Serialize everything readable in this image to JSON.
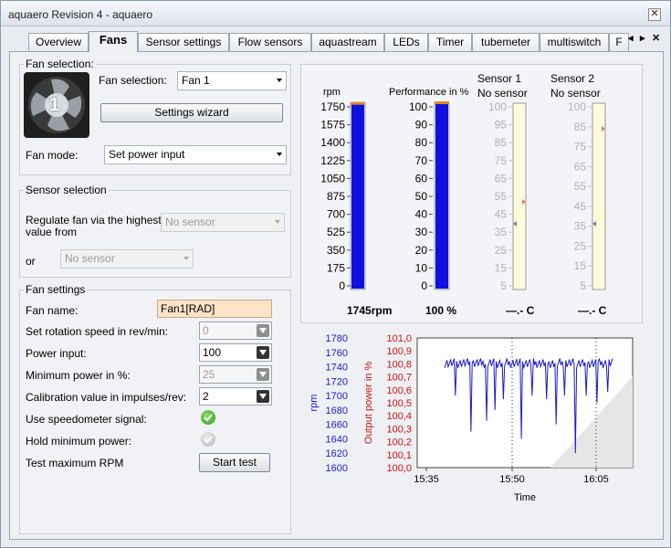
{
  "window": {
    "title": "aquaero Revision 4 -  aquaero",
    "close_icon": "close-icon"
  },
  "tabs": [
    "Overview",
    "Fans",
    "Sensor settings",
    "Flow sensors",
    "aquastream",
    "LEDs",
    "Timer",
    "tubemeter",
    "multiswitch",
    "F"
  ],
  "active_tab": "Fans",
  "tab_nav": {
    "left": "◂",
    "right": "▸",
    "close": "✕"
  },
  "fan_selection": {
    "group_label": "Fan selection:",
    "badge_number": "1",
    "selection_label": "Fan selection:",
    "selection_value": "Fan 1",
    "wizard_button": "Settings wizard",
    "mode_label": "Fan mode:",
    "mode_value": "Set power input"
  },
  "sensor_selection": {
    "group_label": "Sensor selection",
    "regulate_label_1": "Regulate fan via the highest",
    "regulate_label_2": "value from",
    "sensor_a": "No sensor",
    "or_label": "or",
    "sensor_b": "No sensor"
  },
  "fan_settings": {
    "group_label": "Fan settings",
    "name_label": "Fan name:",
    "name_value": "Fan1[RAD]",
    "rotation_label": "Set rotation speed in rev/min:",
    "rotation_value": "0",
    "power_label": "Power input:",
    "power_value": "100",
    "min_power_label": "Minimum power in %:",
    "min_power_value": "25",
    "calibration_label": "Calibration value in impulses/rev:",
    "calibration_value": "2",
    "speedometer_label": "Use speedometer signal:",
    "speedometer_checked": true,
    "hold_label": "Hold minimum power:",
    "hold_checked": false,
    "test_label": "Test maximum RPM",
    "test_button": "Start test"
  },
  "gauges": {
    "rpm": {
      "header": "rpm",
      "ticks": [
        "1750",
        "1575",
        "1400",
        "1225",
        "1050",
        "875",
        "700",
        "525",
        "350",
        "175",
        "0"
      ],
      "max": 1750,
      "value": 1745,
      "readout": "1745rpm",
      "color": "#1010e0"
    },
    "perf": {
      "header": "Performance in %",
      "ticks": [
        "100",
        "90",
        "80",
        "70",
        "60",
        "50",
        "40",
        "30",
        "20",
        "10",
        "0"
      ],
      "max": 100,
      "value": 100,
      "readout": "100 %",
      "color": "#1010e0"
    },
    "sensor1": {
      "header_1": "Sensor 1",
      "header_2": "No sensor",
      "ticks": [
        "100",
        "95",
        "85",
        "75",
        "65",
        "55",
        "45",
        "35",
        "25",
        "15",
        "5"
      ],
      "readout": "—.- C"
    },
    "sensor2": {
      "header_1": "Sensor 2",
      "header_2": "No sensor",
      "ticks": [
        "100",
        "85",
        "75",
        "65",
        "55",
        "45",
        "35",
        "25",
        "15",
        "5"
      ],
      "readout": "—.- C"
    }
  },
  "chart_data": {
    "type": "line",
    "xlabel": "Time",
    "x_ticks": [
      "15:35",
      "15:50",
      "16:05"
    ],
    "left_axis": {
      "label": "rpm",
      "color": "#1a1acc",
      "ticks": [
        "1780",
        "1760",
        "1740",
        "1720",
        "1700",
        "1680",
        "1660",
        "1640",
        "1620",
        "1600"
      ],
      "ylim": [
        1600,
        1780
      ]
    },
    "right_axis": {
      "label": "Output power in %",
      "color": "#d01010",
      "ticks": [
        "101,0",
        "100,9",
        "100,8",
        "100,7",
        "100,6",
        "100,5",
        "100,4",
        "100,3",
        "100,2",
        "100,1",
        "100,0"
      ],
      "ylim": [
        100.0,
        101.0
      ]
    },
    "series": [
      {
        "axis": "left",
        "color": "#1a1acc",
        "baseline": 1745,
        "dips": [
          [
            15.4,
            1700
          ],
          [
            15.47,
            1650
          ],
          [
            15.54,
            1665
          ],
          [
            15.58,
            1680
          ],
          [
            15.62,
            1695
          ],
          [
            15.7,
            1640
          ],
          [
            15.75,
            1700
          ],
          [
            15.82,
            1695
          ],
          [
            15.86,
            1660
          ],
          [
            15.9,
            1700
          ],
          [
            15.95,
            1620
          ],
          [
            16.0,
            1700
          ],
          [
            16.05,
            1690
          ],
          [
            16.1,
            1705
          ]
        ]
      }
    ],
    "grid": true
  }
}
